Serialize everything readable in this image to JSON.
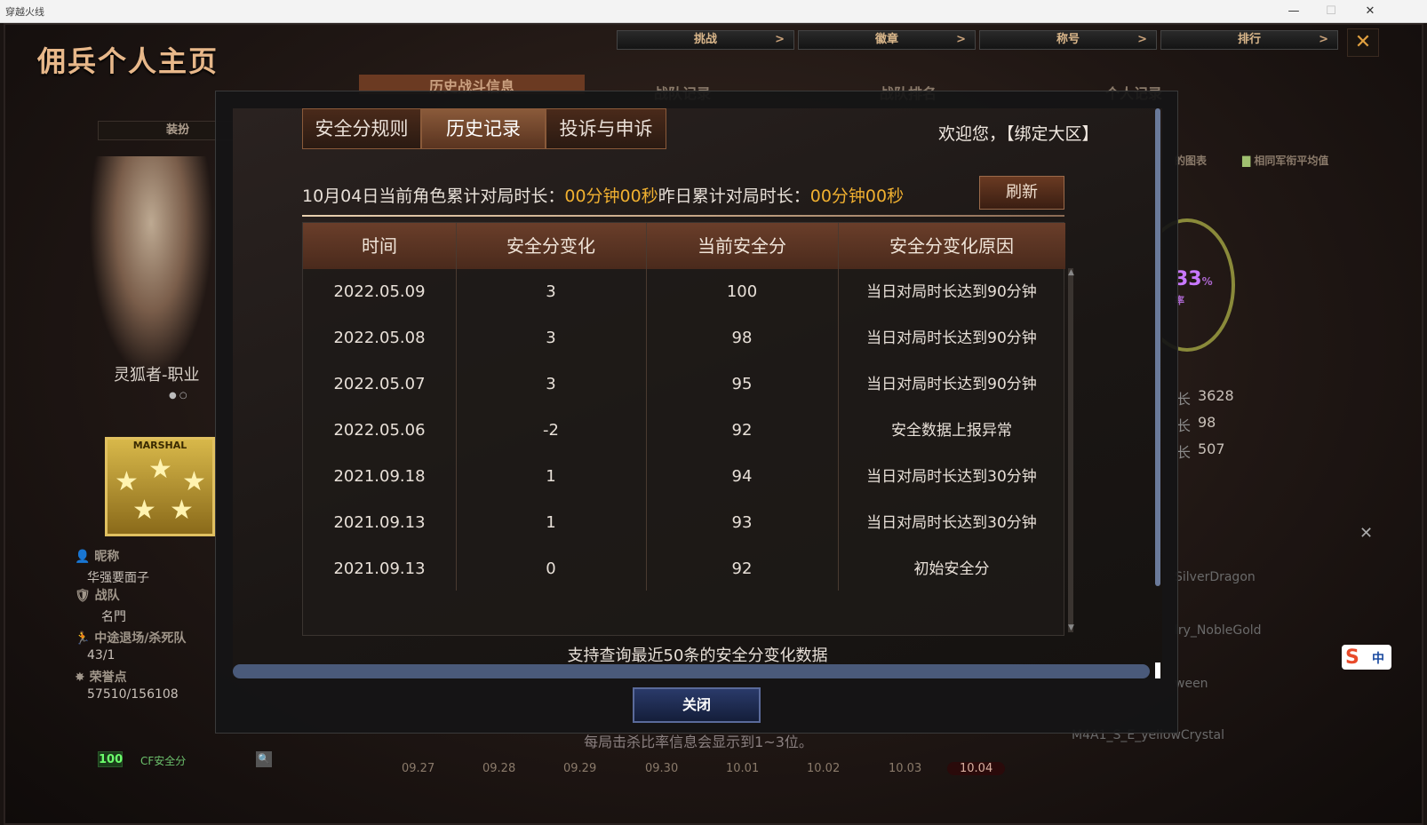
{
  "window": {
    "app_title": "穿越火线",
    "min_label": "—",
    "max_label": "☐",
    "close_label": "✕"
  },
  "background": {
    "page_title": "佣兵个人主页",
    "top_nav": [
      "挑战",
      "徽章",
      "称号",
      "排行"
    ],
    "top_nav_chevron": ">",
    "close_label": "✕",
    "sub_tabs": [
      "历史战斗信息",
      "战队记录",
      "战队排名",
      "个人记录"
    ],
    "left_label": "装扮",
    "character_name": "灵狐者-职业",
    "dots": "● ○",
    "badge_label": "MARSHAL",
    "info": [
      {
        "label": "👤 昵称",
        "value": "华强要面子"
      },
      {
        "label": "🛡 战队",
        "value": "名門"
      },
      {
        "label": "🏃 中途退场/杀死队",
        "value": "43/1"
      },
      {
        "label": "✸ 荣誉点",
        "value": "57510/156108"
      }
    ],
    "cf_score_value": "100",
    "cf_score_label": "CF安全分",
    "search_glyph": "🔍",
    "bottom_note": "每局击杀比率信息会显示到1~3位。",
    "date_ticks": [
      "09.27",
      "09.28",
      "09.29",
      "09.30",
      "10.01",
      "10.02",
      "10.03",
      "10.04"
    ],
    "right_legend": [
      "的图表",
      "相同军衔平均值"
    ],
    "gauge_value": "33",
    "gauge_percent": "%",
    "gauge_sub": "率",
    "stat_dash": "长",
    "stats": [
      "3628",
      "98",
      "507"
    ],
    "players": [
      "SilverDragon",
      "lry_NobleGold",
      "ween",
      "M4A1_S_E_yellowCrystal"
    ],
    "side_close": "✕",
    "ime_s": "S",
    "ime_zh": "中"
  },
  "modal": {
    "tabs": [
      "安全分规则",
      "历史记录",
      "投诉与申诉"
    ],
    "active_tab": 1,
    "welcome": "欢迎您，【绑定大区】",
    "summary": {
      "date_prefix": "10月04日当前角色累计对局时长：",
      "today_value": "00分钟00秒",
      "yesterday_prefix": "昨日累计对局时长：",
      "yesterday_value": "00分钟00秒"
    },
    "refresh_label": "刷新",
    "table": {
      "headers": [
        "时间",
        "安全分变化",
        "当前安全分",
        "安全分变化原因"
      ],
      "rows": [
        [
          "2022.05.09",
          "3",
          "100",
          "当日对局时长达到90分钟"
        ],
        [
          "2022.05.08",
          "3",
          "98",
          "当日对局时长达到90分钟"
        ],
        [
          "2022.05.07",
          "3",
          "95",
          "当日对局时长达到90分钟"
        ],
        [
          "2022.05.06",
          "-2",
          "92",
          "安全数据上报异常"
        ],
        [
          "2021.09.18",
          "1",
          "94",
          "当日对局时长达到30分钟"
        ],
        [
          "2021.09.13",
          "1",
          "93",
          "当日对局时长达到30分钟"
        ],
        [
          "2021.09.13",
          "0",
          "92",
          "初始安全分"
        ]
      ]
    },
    "scroll_up": "▲",
    "scroll_down": "▼",
    "footnote": "支持查询最近50条的安全分变化数据",
    "close_label": "关闭"
  },
  "colors": {
    "accent_orange": "#f0b030",
    "tab_border": "#8a5a3a",
    "header_brown": "#6a3e2a",
    "close_blue": "#2a3a6a"
  }
}
